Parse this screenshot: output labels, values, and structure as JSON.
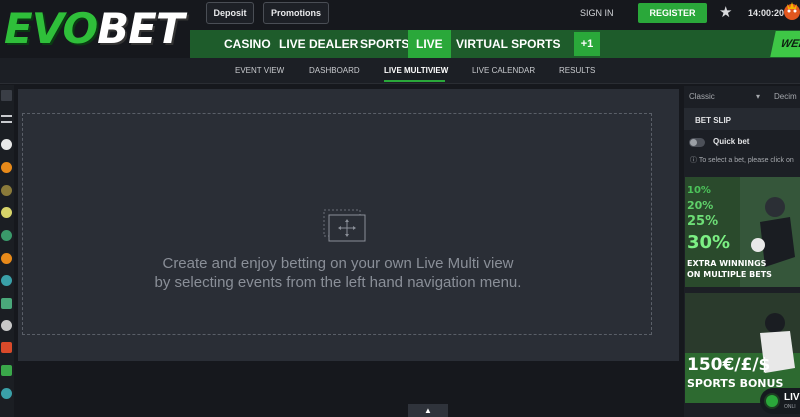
{
  "header": {
    "logo_evo": "EVO",
    "logo_bet": "BET",
    "deposit_label": "Deposit",
    "promotions_label": "Promotions",
    "signin_label": "SIGN IN",
    "register_label": "REGISTER",
    "clock": "14:00:20"
  },
  "nav": {
    "items": [
      "CASINO",
      "LIVE DEALER",
      "SPORTS",
      "LIVE",
      "VIRTUAL SPORTS"
    ],
    "active": "LIVE",
    "plus_label": "+1",
    "week_label": "WEE"
  },
  "subnav": {
    "items": [
      "EVENT VIEW",
      "DASHBOARD",
      "LIVE MULTIVIEW",
      "LIVE CALENDAR",
      "RESULTS"
    ],
    "active": "LIVE MULTIVIEW"
  },
  "main": {
    "message_line1": "Create and enjoy betting on your own Live Multi view",
    "message_line2": "by selecting events from the left hand navigation menu."
  },
  "betslip": {
    "odds_format": "Classic",
    "decimal_label": "Decim",
    "title": "BET SLIP",
    "quickbet_label": "Quick bet",
    "hint": "To select a bet, please click on"
  },
  "promo1": {
    "lines": [
      "10%",
      "20%",
      "25%",
      "30%"
    ],
    "caption1": "EXTRA WINNINGS",
    "caption2": "ON MULTIPLE BETS"
  },
  "promo2": {
    "amount": "150€/£/$",
    "caption": "SPORTS BONUS"
  },
  "live_badge": {
    "label": "LIV",
    "sub": "ONLI"
  },
  "colors": {
    "accent_green": "#2aa83a",
    "nav_green": "#1e5c2b",
    "background": "#16181d",
    "panel": "#2a2e36"
  }
}
